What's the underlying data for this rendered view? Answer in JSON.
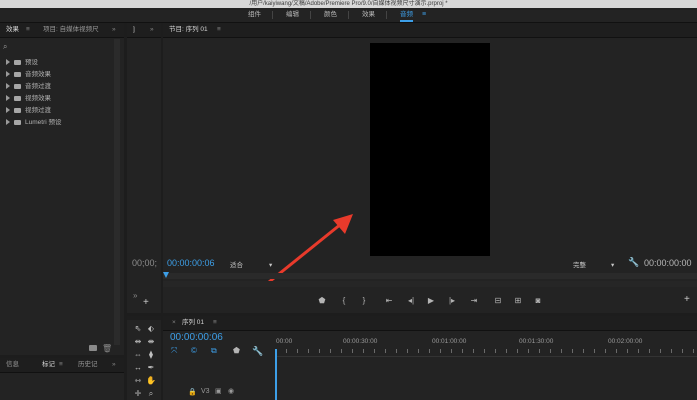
{
  "window": {
    "title": "/用户/kaiyiwang/文稿/Adobe/Premiere Pro/9.0/自媒体视频尺寸演示.prproj *"
  },
  "workspaces": {
    "items": [
      "组件",
      "编辑",
      "颜色",
      "效果",
      "音频"
    ],
    "active": "音频"
  },
  "effects_panel": {
    "tab_effects": "效果",
    "tab_project": "项目: 自媒体视频尺",
    "items": [
      "预设",
      "音频效果",
      "音频过渡",
      "视频效果",
      "视频过渡",
      "Lumetri 预设"
    ]
  },
  "source_panel": {
    "timecode": "00;00;"
  },
  "program_panel": {
    "tab_label": "节目: 序列 01",
    "timecode_current": "00:00:00:06",
    "timecode_duration": "00:00:00:00",
    "zoom_value": "适合",
    "quality_value": "完整"
  },
  "timeline_panel": {
    "tab_label": "序列 01",
    "timecode": "00:00:00:06",
    "track_label": "V3",
    "ruler": [
      "00:00",
      "00:00:30:00",
      "00:01:00:00",
      "00:01:30:00",
      "00:02:00:00"
    ]
  },
  "bottom_left_tabs": {
    "info": "信息",
    "markers": "标记",
    "history": "历史记"
  },
  "colors": {
    "accent": "#3d9fe8",
    "annotation_arrow": "#e83a2b",
    "video_frame": "#000000"
  },
  "icons": [
    "search-icon",
    "menu-icon",
    "wrench-icon",
    "marker-icon",
    "play-icon",
    "camera-icon",
    "selection-tool-icon",
    "razor-tool-icon",
    "hand-tool-icon",
    "zoom-tool-icon"
  ]
}
